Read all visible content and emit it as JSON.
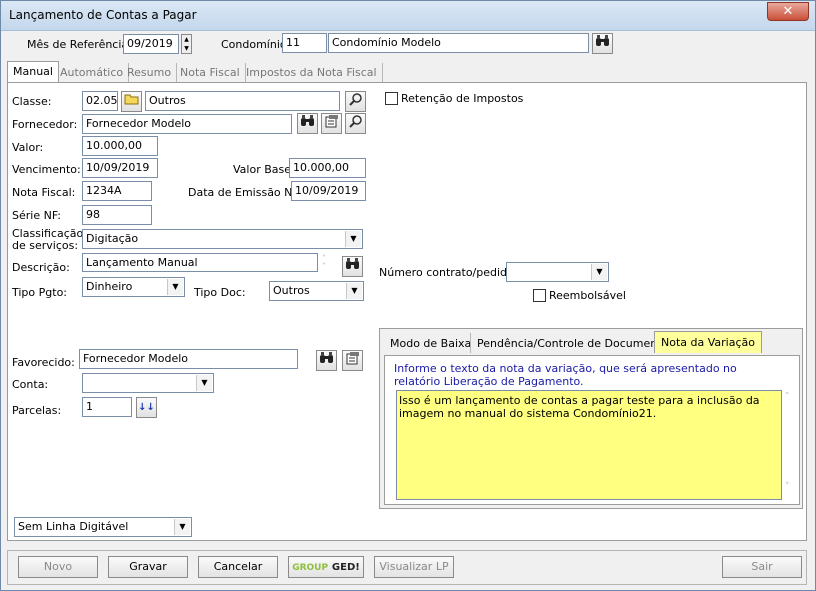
{
  "window": {
    "title": "Lançamento de Contas a Pagar",
    "close_glyph": "✕"
  },
  "header": {
    "mes_label": "Mês de Referência:",
    "mes_value": "09/2019",
    "condominio_label": "Condomínio:",
    "condominio_code": "11",
    "condominio_name": "Condomínio Modelo"
  },
  "tabs": [
    "Manual",
    "Automático",
    "Resumo",
    "Nota Fiscal",
    "Impostos da Nota Fiscal"
  ],
  "form": {
    "classe_label": "Classe:",
    "classe_code": "02.05",
    "classe_name": "Outros",
    "fornecedor_label": "Fornecedor:",
    "fornecedor_value": "Fornecedor Modelo",
    "valor_label": "Valor:",
    "valor_value": "10.000,00",
    "vencimento_label": "Vencimento:",
    "vencimento_value": "10/09/2019",
    "valor_base_label": "Valor Base:",
    "valor_base_value": "10.000,00",
    "nota_fiscal_label": "Nota Fiscal:",
    "nota_fiscal_value": "1234A",
    "data_emissao_label": "Data de Emissão NF:",
    "data_emissao_value": "10/09/2019",
    "serie_label": "Série NF:",
    "serie_value": "98",
    "classificacao_label_1": "Classificação",
    "classificacao_label_2": "de serviços:",
    "classificacao_value": "Digitação",
    "descricao_label": "Descrição:",
    "descricao_value": "Lançamento Manual",
    "tipo_pgto_label": "Tipo Pgto:",
    "tipo_pgto_value": "Dinheiro",
    "tipo_doc_label": "Tipo Doc:",
    "tipo_doc_value": "Outros",
    "favorecido_label": "Favorecido:",
    "favorecido_value": "Fornecedor Modelo",
    "conta_label": "Conta:",
    "conta_value": "",
    "parcelas_label": "Parcelas:",
    "parcelas_value": "1",
    "linha_digitavel_value": "Sem Linha Digitável",
    "retencao_label": "Retenção de Impostos",
    "contrato_label": "Número contrato/pedido:",
    "contrato_value": "",
    "reembolsavel_label": "Reembolsável"
  },
  "subtabs": {
    "items": [
      "Modo de Baixa",
      "Pendência/Controle de Documentos",
      "Nota da Variação"
    ],
    "info_text": "Informe o texto da nota da variação, que será apresentado no relatório Liberação de Pagamento.",
    "note_text": "Isso é um lançamento de contas a pagar teste para a inclusão da imagem no manual do sistema Condomínio21."
  },
  "buttons": {
    "novo": "Novo",
    "gravar": "Gravar",
    "cancelar": "Cancelar",
    "group_ged_1": "GROUP",
    "group_ged_2": "GED!",
    "visualizar": "Visualizar LP",
    "sair": "Sair"
  },
  "colors": {
    "note_bg": "#ffff80",
    "active_subtab_bg": "#ffff9c",
    "info_text": "#1a1aa6",
    "titlebar": "#c4d7ec"
  }
}
